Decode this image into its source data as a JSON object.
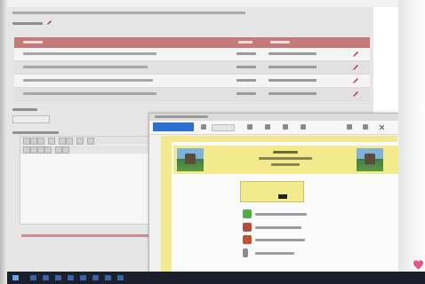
{
  "page": {
    "heading_text": "",
    "section_title": "",
    "table": {
      "columns": [
        "",
        "",
        ""
      ],
      "rows": [
        {
          "name": "",
          "size": "",
          "date": ""
        },
        {
          "name": "",
          "size": "",
          "date": ""
        },
        {
          "name": "",
          "size": "",
          "date": ""
        },
        {
          "name": "",
          "size": "",
          "date": ""
        }
      ]
    },
    "field_label": "",
    "field_value": "",
    "editor_label": ""
  },
  "popup": {
    "window_title": "",
    "tab_label": "",
    "document": {
      "header_title": "",
      "header_subtitle": "",
      "items": [
        "",
        "",
        "",
        ""
      ]
    }
  },
  "colors": {
    "table_header": "#c27a7a",
    "edit_icon": "#b0392e",
    "document_accent": "#f3e98d",
    "window_tab": "#2f6fd0"
  },
  "icons": [
    "edit-icon",
    "pencil-icon",
    "heart-icon",
    "close-icon"
  ]
}
